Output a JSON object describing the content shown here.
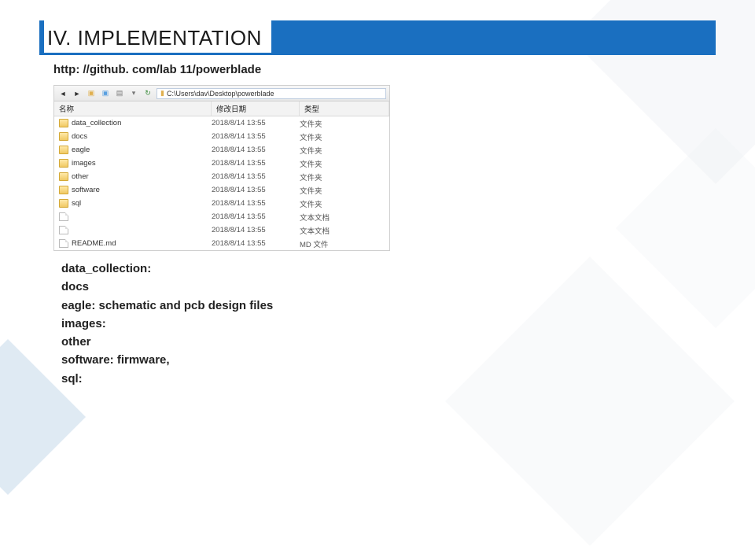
{
  "title": "IV. IMPLEMENTATION",
  "url": "http: //github. com/lab 11/powerblade",
  "explorer": {
    "path": "C:\\Users\\dav\\Desktop\\powerblade",
    "columns": {
      "name": "名称",
      "date": "修改日期",
      "type": "类型"
    },
    "rows": [
      {
        "icon": "folder",
        "name": "data_collection",
        "date": "2018/8/14 13:55",
        "type": "文件夹"
      },
      {
        "icon": "folder",
        "name": "docs",
        "date": "2018/8/14 13:55",
        "type": "文件夹"
      },
      {
        "icon": "folder",
        "name": "eagle",
        "date": "2018/8/14 13:55",
        "type": "文件夹"
      },
      {
        "icon": "folder",
        "name": "images",
        "date": "2018/8/14 13:55",
        "type": "文件夹"
      },
      {
        "icon": "folder",
        "name": "other",
        "date": "2018/8/14 13:55",
        "type": "文件夹"
      },
      {
        "icon": "folder",
        "name": "software",
        "date": "2018/8/14 13:55",
        "type": "文件夹"
      },
      {
        "icon": "folder",
        "name": "sql",
        "date": "2018/8/14 13:55",
        "type": "文件夹"
      },
      {
        "icon": "file",
        "name": "",
        "date": "2018/8/14 13:55",
        "type": "文本文档"
      },
      {
        "icon": "file",
        "name": "",
        "date": "2018/8/14 13:55",
        "type": "文本文档"
      },
      {
        "icon": "file",
        "name": "README.md",
        "date": "2018/8/14 13:55",
        "type": "MD 文件"
      }
    ]
  },
  "descriptions": [
    "data_collection:",
    "docs",
    "eagle:  schematic and pcb design files",
    "images:",
    "other",
    "software: firmware,",
    "sql:"
  ]
}
